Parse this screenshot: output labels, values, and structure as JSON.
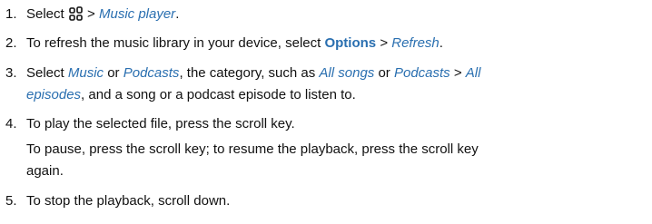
{
  "steps": [
    {
      "number": "1.",
      "t1": "Select",
      "icon": "menu-key-icon",
      "sep": ">",
      "music_player": "Music player",
      "end": "."
    },
    {
      "number": "2.",
      "t1": "To refresh the music library in your device, select",
      "options": "Options",
      "sep": ">",
      "refresh": "Refresh",
      "end": "."
    },
    {
      "number": "3.",
      "t1": "Select",
      "music": "Music",
      "or": "or",
      "podcasts": "Podcasts",
      "t2": ", the category, such as",
      "all_songs": "All songs",
      "or2": "or",
      "podcasts2": "Podcasts",
      "sep": ">",
      "all": "All",
      "episodes": "episodes",
      "t3": ", and a song or a podcast episode to listen to."
    },
    {
      "number": "4.",
      "t1": "To play the selected file, press the scroll key.",
      "sub1": "To pause, press the scroll key; to resume the playback, press the scroll key",
      "sub2": "again."
    },
    {
      "number": "5.",
      "t1": "To stop the playback, scroll down."
    }
  ]
}
